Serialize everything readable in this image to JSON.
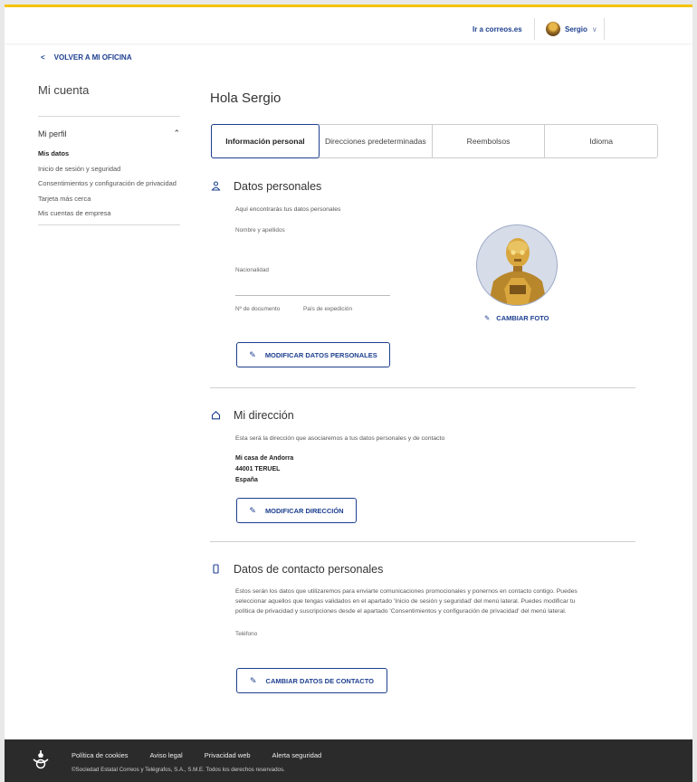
{
  "header": {
    "correos_link": "Ir a correos.es",
    "user_name": "Sergio"
  },
  "back_link": "VOLVER A MI OFICINA",
  "sidebar": {
    "title": "Mi cuenta",
    "section": "Mi perfil",
    "items": [
      {
        "label": "Mis datos",
        "active": true
      },
      {
        "label": "Inicio de sesión y seguridad"
      },
      {
        "label": "Consentimientos y configuración de privacidad"
      },
      {
        "label": "Tarjeta más cerca"
      },
      {
        "label": "Mis cuentas de empresa"
      }
    ]
  },
  "main": {
    "greeting": "Hola Sergio",
    "tabs": [
      {
        "label": "Información personal",
        "active": true
      },
      {
        "label": "Direcciones predeterminadas"
      },
      {
        "label": "Reembolsos"
      },
      {
        "label": "Idioma"
      }
    ]
  },
  "datos_personales": {
    "title": "Datos personales",
    "description": "Aquí encontrarás tus datos personales",
    "name_label": "Nombre y apellidos",
    "nationality_label": "Nacionalidad",
    "document_label": "Nº de documento",
    "issuing_country_label": "País de expedición",
    "change_photo": "CAMBIAR FOTO",
    "modify_button": "MODIFICAR DATOS PERSONALES"
  },
  "direccion": {
    "title": "Mi dirección",
    "description": "Esta será la dirección que asociaremos a tus datos personales y de contacto",
    "line1": "Mi casa de Andorra",
    "line2": "44001 TERUEL",
    "line3": "España",
    "modify_button": "MODIFICAR DIRECCIÓN"
  },
  "contacto": {
    "title": "Datos de contacto personales",
    "description_1": "Estos serán los datos que utilizaremos para enviarte comunicaciones promocionales y ponernos en contacto contigo. Puedes",
    "description_2": "seleccionar aquellos que tengas validados en el apartado 'Inicio de sesión y seguridad' del menú lateral. Puedes modificar tu",
    "description_3": "política de privacidad y suscripciones desde el apartado 'Consentimientos y configuración de privacidad' del menú lateral.",
    "phone_label": "Teléfono",
    "change_button": "CAMBIAR DATOS DE CONTACTO"
  },
  "footer": {
    "links": [
      "Política de cookies",
      "Aviso legal",
      "Privacidad web",
      "Alerta seguridad"
    ],
    "copyright": "©Sociedad Estatal Correos y Telégrafos, S.A., S.M.E. Todos los derechos reservados."
  },
  "colors": {
    "brand_blue": "#1d3f8f",
    "brand_yellow": "#f4c300",
    "footer_bg": "#2b2b2b"
  }
}
